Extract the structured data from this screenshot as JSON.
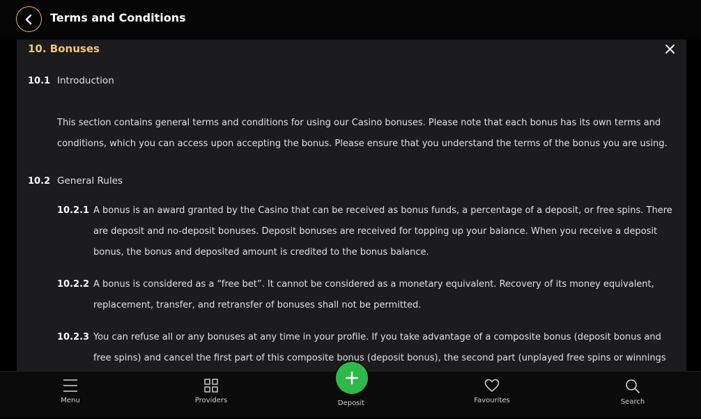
{
  "header": {
    "title": "Terms and Conditions",
    "back_icon": "chevron-left-icon"
  },
  "section": {
    "title": "10. Bonuses",
    "close_icon": "close-icon",
    "accent_color": "#f2c677",
    "items": [
      {
        "number": "10.1",
        "label": "Introduction"
      },
      {
        "number": "10.2",
        "label": "General Rules"
      }
    ],
    "intro_text": "This section contains general terms and conditions for using our Casino bonuses. Please note that each bonus has its own terms and conditions, which you can access upon accepting the bonus. Please ensure that you understand the terms of the bonus you are using.",
    "rules": [
      {
        "number": "10.2.1",
        "text": "A bonus is an award granted by the Casino that can be received as bonus funds, a percentage of a deposit, or free spins. There are deposit and no-deposit bonuses. Deposit bonuses are received for topping up your balance. When you receive a deposit bonus, the bonus and deposited amount is credited to the bonus balance."
      },
      {
        "number": "10.2.2",
        "text": "A bonus is considered as a “free bet”. It cannot be considered as a monetary equivalent. Recovery of its money equivalent, replacement, transfer, and retransfer of bonuses shall not be permitted."
      },
      {
        "number": "10.2.3",
        "text": "You can refuse all or any bonuses at any time in your profile. If you take advantage of a composite bonus (deposit bonus and free spins) and cancel the first part of this composite bonus (deposit bonus), the second part (unplayed free spins or winnings"
      }
    ]
  },
  "bottom_nav": {
    "menu": {
      "label": "Menu",
      "icon": "hamburger-menu-icon"
    },
    "providers": {
      "label": "Providers",
      "icon": "grid-icon"
    },
    "deposit": {
      "label": "Deposit",
      "icon": "plus-icon",
      "color": "#2eb84a"
    },
    "favourites": {
      "label": "Favourites",
      "icon": "heart-icon"
    },
    "search": {
      "label": "Search",
      "icon": "search-icon"
    }
  }
}
